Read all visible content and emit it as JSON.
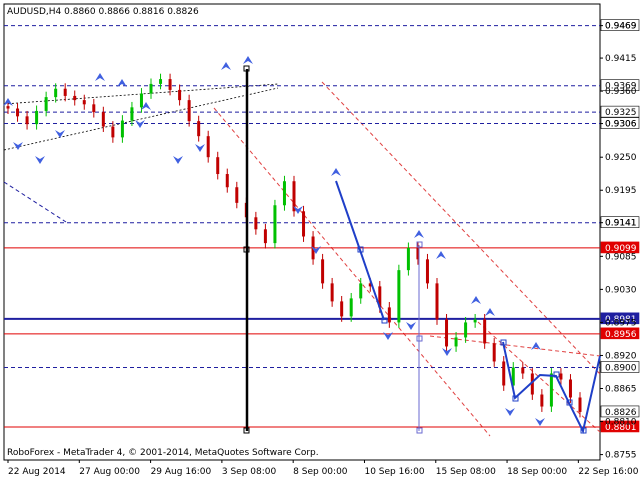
{
  "header": {
    "symbol": "AUDUSD,H4",
    "ohlc": "0.8860 0.8866 0.8816 0.8826"
  },
  "footer": {
    "copyright": "RoboForex - MetaTrader 4, © 2001-2014, MetaQuotes Software Corp."
  },
  "colors": {
    "background": "#ffffff",
    "bull_candle": "#00c000",
    "bear_candle": "#c00000",
    "wave_line": "#1f3fc8",
    "channel": "#e04040",
    "support_line": "#1f1fa0",
    "level_red": "#e00000",
    "fractal_arrow": "#4060e0"
  },
  "chart_data": {
    "type": "candlestick",
    "ylim": [
      0.8746,
      0.9505
    ],
    "y_ticks": [
      "0.9469",
      "0.9415",
      "0.9360",
      "0.9306",
      "0.9250",
      "0.9195",
      "0.9141",
      "0.9085",
      "0.9030",
      "0.8975",
      "0.8920",
      "0.8865",
      "0.8810",
      "0.8755"
    ],
    "x_ticks": [
      "22 Aug 2014",
      "27 Aug 00:00",
      "29 Aug 16:00",
      "3 Sep 08:00",
      "8 Sep 00:00",
      "10 Sep 16:00",
      "15 Sep 08:00",
      "18 Sep 00:00",
      "22 Sep 16:00"
    ],
    "grid": false,
    "horizontal_levels": [
      {
        "label": "0.9469",
        "style": "dashed",
        "color": "navy"
      },
      {
        "label": "0.9369",
        "style": "dashed",
        "color": "navy"
      },
      {
        "label": "0.9325",
        "style": "dashed",
        "color": "navy"
      },
      {
        "label": "0.9306",
        "style": "dashed",
        "color": "navy"
      },
      {
        "label": "0.9141",
        "style": "dashed",
        "color": "navy"
      },
      {
        "label": "0.9099",
        "style": "solid",
        "color": "red"
      },
      {
        "label": "0.8981",
        "style": "solid-thick",
        "color": "blue"
      },
      {
        "label": "0.8956",
        "style": "solid",
        "color": "red"
      },
      {
        "label": "0.8900",
        "style": "dashed",
        "color": "navy"
      },
      {
        "label": "0.8826",
        "style": "current",
        "color": "black"
      },
      {
        "label": "0.8801",
        "style": "solid",
        "color": "red"
      }
    ],
    "close_path": [
      0.9331,
      0.9318,
      0.9305,
      0.9327,
      0.935,
      0.9364,
      0.9352,
      0.9345,
      0.9338,
      0.9325,
      0.9301,
      0.9283,
      0.9311,
      0.9333,
      0.9356,
      0.9372,
      0.938,
      0.9362,
      0.9345,
      0.931,
      0.9285,
      0.925,
      0.9222,
      0.92,
      0.9174,
      0.915,
      0.913,
      0.9107,
      0.917,
      0.921,
      0.916,
      0.9118,
      0.908,
      0.904,
      0.901,
      0.8985,
      0.9015,
      0.904,
      0.9035,
      0.9,
      0.8975,
      0.9062,
      0.9099,
      0.908,
      0.904,
      0.898,
      0.8935,
      0.895,
      0.8975,
      0.898,
      0.894,
      0.891,
      0.887,
      0.89,
      0.889,
      0.8855,
      0.8835,
      0.889,
      0.888,
      0.885,
      0.8826
    ]
  }
}
